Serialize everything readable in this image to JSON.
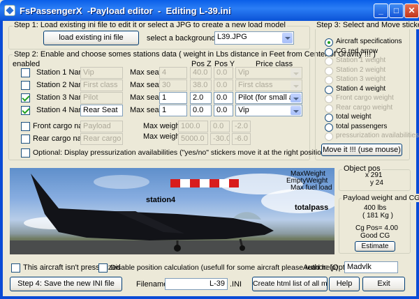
{
  "window": {
    "title": "FsPassengerX  -Payload editor  -  Editing L-39.ini",
    "min": "_",
    "max": "□",
    "close": "✕"
  },
  "step1": {
    "legend": "Step 1:  Load existing ini file to edit it or select a JPG to create a new load model",
    "load_button": "load existing ini file",
    "bg_label": "select a background",
    "bg_value": "L39.JPG"
  },
  "step2": {
    "legend": "Step 2:  Enable and choose somes stations data ( weight in Lbs distance in Feet from Center of Gravity  !!! )",
    "headers": {
      "enabled": "enabled",
      "posz": "Pos Z",
      "posy": "Pos Y",
      "price": "Price class"
    },
    "stations": [
      {
        "label": "Station 1 Name",
        "checked": false,
        "name": "Vip",
        "seat_label": "Max seat",
        "seat": "4",
        "posz": "40.0",
        "posy": "0.0",
        "price": "Vip",
        "enabled": false
      },
      {
        "label": "Station 2 Name",
        "checked": false,
        "name": "First class",
        "seat_label": "Max seat",
        "seat": "30",
        "posz": "38.0",
        "posy": "0.0",
        "price": "First class",
        "enabled": false
      },
      {
        "label": "Station 3 Name",
        "checked": true,
        "name": "Pilot",
        "seat_label": "Max seat",
        "seat": "1",
        "posz": "2.0",
        "posy": "0.0",
        "price": "Pilot (for small aircraft",
        "enabled": true
      },
      {
        "label": "Station 4 Name",
        "checked": true,
        "name": "Rear Seat",
        "seat_label": "Max seat",
        "seat": "1",
        "posz": "0.0",
        "posy": "0.0",
        "price": "Vip",
        "enabled": true
      }
    ],
    "cargo": [
      {
        "label": "Front cargo name",
        "checked": false,
        "name": "Payload",
        "weight_label": "Max weight",
        "weight": "100.0",
        "posz": "0.0",
        "posy": "-2.0"
      },
      {
        "label": "Rear cargo name",
        "checked": false,
        "name": "Rear cargo",
        "weight_label": "Max weight",
        "weight": "5000.0",
        "posz": "-30.0",
        "posy": "-6.0"
      }
    ],
    "optional": "Optional: Display pressurization availabilities (\"yes/no\" stickers move it at the right position)"
  },
  "step3": {
    "legend": "Step 3: Select and Move stickers",
    "items": [
      {
        "label": "Aircraft specifications",
        "selected": true,
        "enabled": true
      },
      {
        "label": "CG red arrow",
        "selected": false,
        "enabled": true
      },
      {
        "label": "Station 1 weight",
        "selected": false,
        "enabled": false
      },
      {
        "label": "Station 2 weight",
        "selected": false,
        "enabled": false
      },
      {
        "label": "Station 3 weight",
        "selected": false,
        "enabled": false
      },
      {
        "label": "Station 4 weight",
        "selected": false,
        "enabled": true
      },
      {
        "label": "Front cargo weight",
        "selected": false,
        "enabled": false
      },
      {
        "label": "Rear cargo weight",
        "selected": false,
        "enabled": false
      },
      {
        "label": "total weight",
        "selected": false,
        "enabled": true
      },
      {
        "label": "total passengers",
        "selected": false,
        "enabled": true
      },
      {
        "label": "pressurization availabilities",
        "selected": false,
        "enabled": false
      }
    ],
    "move_button": "Move it !!!   (use mouse)"
  },
  "preview": {
    "station4": "station4",
    "totalpass": "totalpass",
    "maxweight": "MaxWeight",
    "emptyweight": "EmptyWeight",
    "maxfuel": "Max fuel load"
  },
  "object_pos": {
    "legend": "Object pos",
    "x": "x 291",
    "y": "y 24"
  },
  "payload": {
    "legend": "Payload weight and CG",
    "lbs": "400 lbs",
    "kg": "( 181 Kg )",
    "cg": "Cg Pos= 4.00",
    "status": "Good CG",
    "estimate": "Estimate"
  },
  "bottom": {
    "not_pressurized": "This aircraft isn't pressurized",
    "disable_calc": "Disable position calculation (usefull for some aircraft please read help)",
    "author_label": "Author: (Opt.)",
    "author_value": "Madvlk",
    "save_button": "Step 4:  Save the new INI file",
    "filename_label": "Filename:",
    "filename_value": "L-39",
    "ini_ext": ".INI",
    "html_button": "Create html list of all models",
    "help_button": "Help",
    "exit_button": "Exit"
  }
}
